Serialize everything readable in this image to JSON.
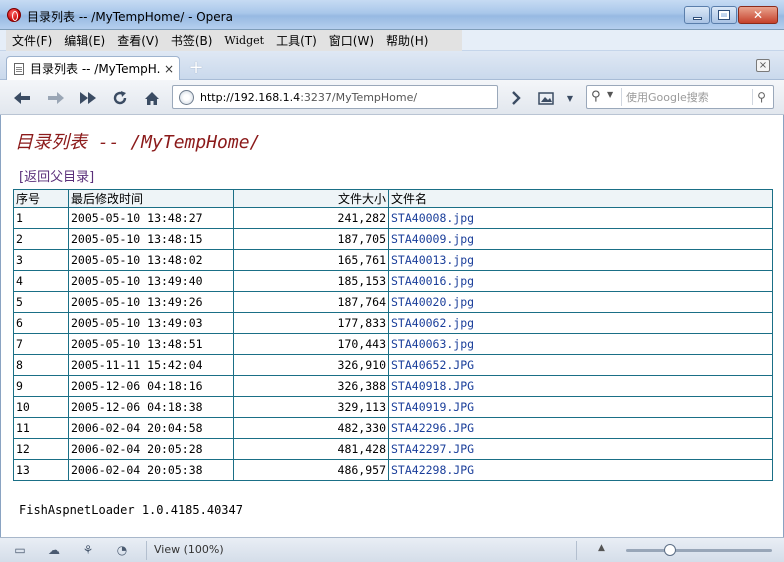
{
  "window": {
    "title": "目录列表 -- /MyTempHome/ - Opera"
  },
  "menu": {
    "items": [
      "文件(F)",
      "编辑(E)",
      "查看(V)",
      "书签(B)",
      "Widget",
      "工具(T)",
      "窗口(W)",
      "帮助(H)"
    ]
  },
  "tab": {
    "label": "目录列表 -- /MyTempH...",
    "close": "×",
    "new_tab": "+"
  },
  "address": {
    "host": "http://192.168.1.4",
    "rest": ":3237/MyTempHome/"
  },
  "search": {
    "placeholder": "使用Google搜索"
  },
  "page": {
    "title": "目录列表 -- /MyTempHome/",
    "parent_link": "返回父目录",
    "bracket_open": "[",
    "bracket_close": "]",
    "footer": "FishAspnetLoader 1.0.4185.40347"
  },
  "table": {
    "headers": [
      "序号",
      "最后修改时间",
      "文件大小",
      "文件名"
    ],
    "rows": [
      [
        "1",
        "2005-05-10 13:48:27",
        "241,282",
        "STA40008.jpg"
      ],
      [
        "2",
        "2005-05-10 13:48:15",
        "187,705",
        "STA40009.jpg"
      ],
      [
        "3",
        "2005-05-10 13:48:02",
        "165,761",
        "STA40013.jpg"
      ],
      [
        "4",
        "2005-05-10 13:49:40",
        "185,153",
        "STA40016.jpg"
      ],
      [
        "5",
        "2005-05-10 13:49:26",
        "187,764",
        "STA40020.jpg"
      ],
      [
        "6",
        "2005-05-10 13:49:03",
        "177,833",
        "STA40062.jpg"
      ],
      [
        "7",
        "2005-05-10 13:48:51",
        "170,443",
        "STA40063.jpg"
      ],
      [
        "8",
        "2005-11-11 15:42:04",
        "326,910",
        "STA40652.JPG"
      ],
      [
        "9",
        "2005-12-06 04:18:16",
        "326,388",
        "STA40918.JPG"
      ],
      [
        "10",
        "2005-12-06 04:18:38",
        "329,113",
        "STA40919.JPG"
      ],
      [
        "11",
        "2006-02-04 20:04:58",
        "482,330",
        "STA42296.JPG"
      ],
      [
        "12",
        "2006-02-04 20:05:28",
        "481,428",
        "STA42297.JPG"
      ],
      [
        "13",
        "2006-02-04 20:05:38",
        "486,957",
        "STA42298.JPG"
      ]
    ]
  },
  "status": {
    "zoom_label": "View (100%)",
    "zoom_level": 0.3
  },
  "icons": {
    "back": "back-arrow-icon",
    "forward": "forward-arrow-icon",
    "fast_forward": "fast-forward-icon",
    "reload": "reload-icon",
    "home": "home-icon"
  }
}
